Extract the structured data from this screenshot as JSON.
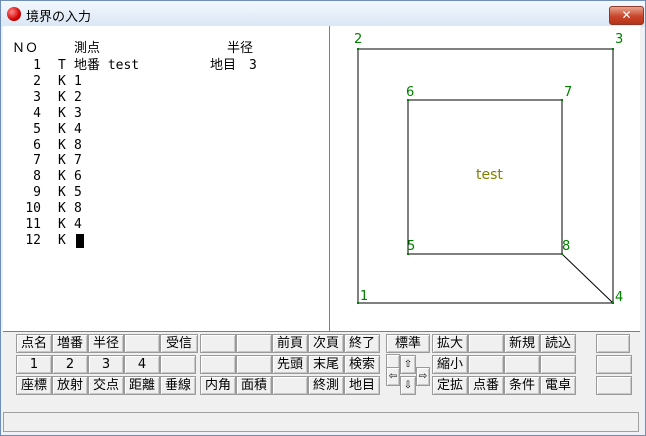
{
  "window": {
    "title": "境界の入力",
    "close_label": "✕"
  },
  "list": {
    "header_no": "ＮＯ",
    "header_point": "測点",
    "header_radius": "半径",
    "rows": [
      {
        "no": "1",
        "type": "T",
        "name": "地番 test",
        "extra": "地目　3"
      },
      {
        "no": "2",
        "type": "K",
        "name": "1",
        "extra": ""
      },
      {
        "no": "3",
        "type": "K",
        "name": "2",
        "extra": ""
      },
      {
        "no": "4",
        "type": "K",
        "name": "3",
        "extra": ""
      },
      {
        "no": "5",
        "type": "K",
        "name": "4",
        "extra": ""
      },
      {
        "no": "6",
        "type": "K",
        "name": "8",
        "extra": ""
      },
      {
        "no": "7",
        "type": "K",
        "name": "7",
        "extra": ""
      },
      {
        "no": "8",
        "type": "K",
        "name": "6",
        "extra": ""
      },
      {
        "no": "9",
        "type": "K",
        "name": "5",
        "extra": ""
      },
      {
        "no": "10",
        "type": "K",
        "name": "8",
        "extra": ""
      },
      {
        "no": "11",
        "type": "K",
        "name": "4",
        "extra": ""
      },
      {
        "no": "12",
        "type": "K",
        "name": "",
        "extra": ""
      }
    ]
  },
  "drawing": {
    "points": [
      {
        "label": "1"
      },
      {
        "label": "2"
      },
      {
        "label": "3"
      },
      {
        "label": "4"
      },
      {
        "label": "5"
      },
      {
        "label": "6"
      },
      {
        "label": "7"
      },
      {
        "label": "8"
      }
    ],
    "parcel_label": "test",
    "colors": {
      "point_label": "#008000",
      "parcel_label": "#808000",
      "line": "#000000"
    }
  },
  "buttons": {
    "row1": [
      "点名",
      "増番",
      "半径",
      "",
      "受信",
      "",
      "",
      "前頁",
      "次頁",
      "終了",
      "標準",
      "拡大",
      "",
      "新規",
      "読込",
      ""
    ],
    "row2": [
      "1",
      "2",
      "3",
      "4",
      "",
      "",
      "",
      "先頭",
      "末尾",
      "検索",
      "縮小",
      "",
      "",
      "",
      ""
    ],
    "row3": [
      "座標",
      "放射",
      "交点",
      "距離",
      "垂線",
      "内角",
      "面積",
      "",
      "終測",
      "地目",
      "定拡",
      "点番",
      "条件",
      "電卓",
      ""
    ],
    "arrows": [
      "",
      "⇧",
      "⇩",
      "⇦",
      "⇨"
    ]
  },
  "status": {
    "text": ""
  }
}
